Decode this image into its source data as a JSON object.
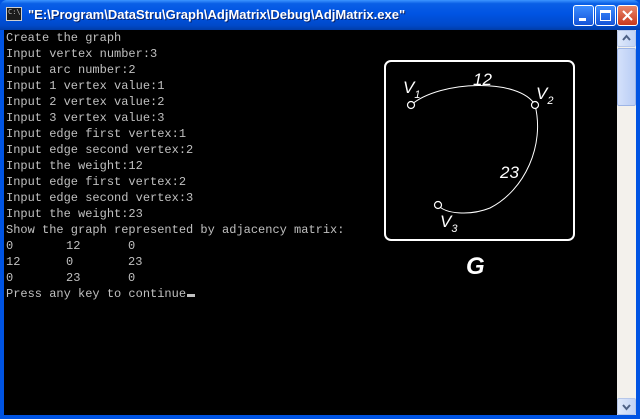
{
  "window": {
    "title": "\"E:\\Program\\DataStru\\Graph\\AdjMatrix\\Debug\\AdjMatrix.exe\"",
    "icon_label": "C:\\"
  },
  "console": {
    "lines": [
      "Create the graph",
      "Input vertex number:3",
      "Input arc number:2",
      "Input 1 vertex value:1",
      "Input 2 vertex value:2",
      "Input 3 vertex value:3",
      "Input edge first vertex:1",
      "Input edge second vertex:2",
      "Input the weight:12",
      "Input edge first vertex:2",
      "Input edge second vertex:3",
      "Input the weight:23",
      "Show the graph represented by adjacency matrix:"
    ],
    "matrix": [
      [
        "0",
        "12",
        "0"
      ],
      [
        "12",
        "0",
        "23"
      ],
      [
        "0",
        "23",
        "0"
      ]
    ],
    "prompt": "Press any key to continue"
  },
  "graph": {
    "title": "G",
    "v1": "V",
    "v1_sub": "1",
    "v2": "V",
    "v2_sub": "2",
    "v3": "V",
    "v3_sub": "3",
    "w12": "12",
    "w23": "23"
  }
}
